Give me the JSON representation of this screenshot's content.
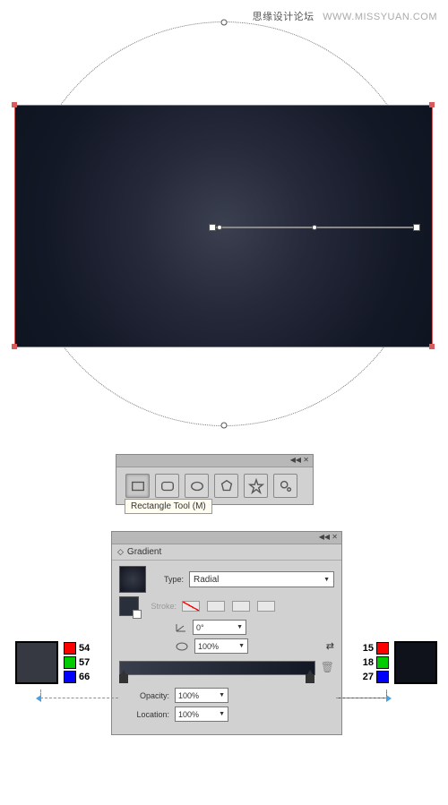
{
  "watermark": {
    "cn": "思缘设计论坛",
    "url": "WWW.MISSYUAN.COM"
  },
  "tools_panel": {
    "tooltip": "Rectangle Tool (M)"
  },
  "gradient_panel": {
    "title": "Gradient",
    "type_label": "Type:",
    "type_value": "Radial",
    "stroke_label": "Stroke:",
    "angle_value": "0°",
    "aspect_value": "100%",
    "opacity_label": "Opacity:",
    "opacity_value": "100%",
    "location_label": "Location:",
    "location_value": "100%"
  },
  "swatches": {
    "left": {
      "r": "54",
      "g": "57",
      "b": "66"
    },
    "right": {
      "r": "15",
      "g": "18",
      "b": "27"
    }
  }
}
